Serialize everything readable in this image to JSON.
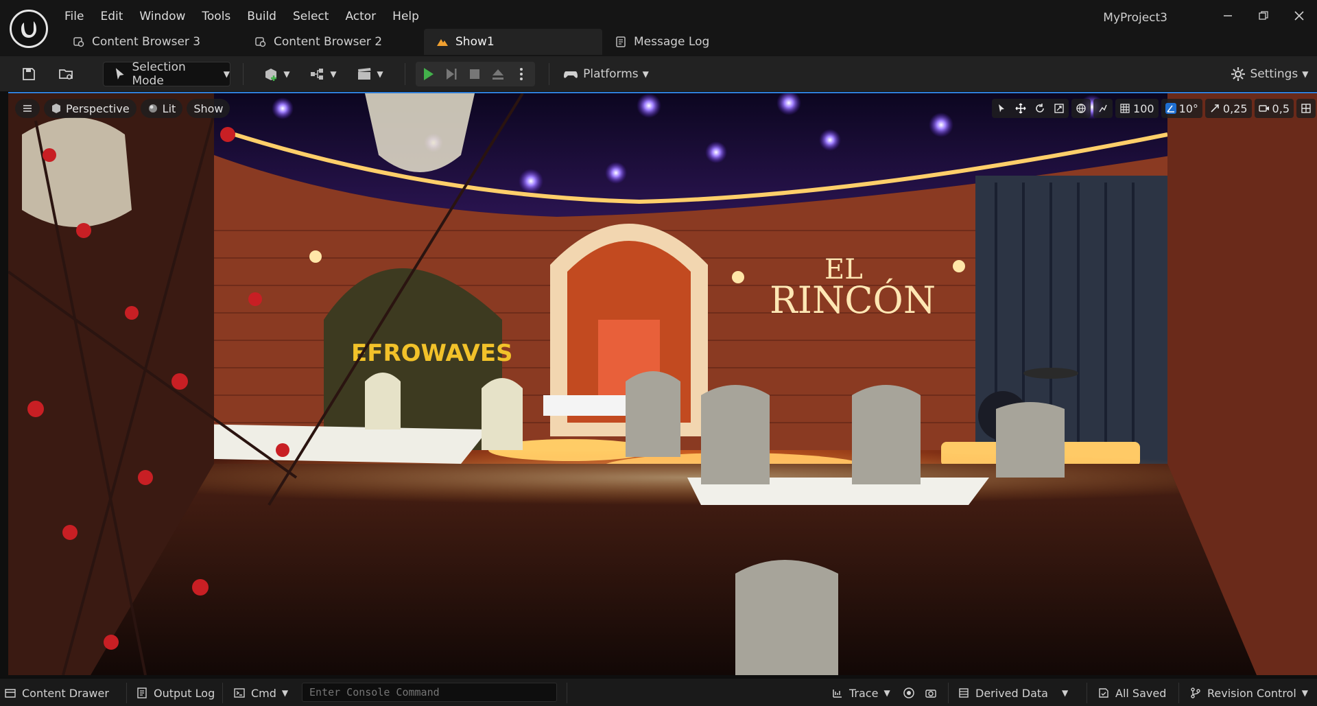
{
  "window": {
    "project_title": "MyProject3"
  },
  "menu": [
    "File",
    "Edit",
    "Window",
    "Tools",
    "Build",
    "Select",
    "Actor",
    "Help"
  ],
  "tabs": {
    "cb3": "Content Browser 3",
    "cb2": "Content Browser 2",
    "show": "Show1",
    "log": "Message Log"
  },
  "toolbar": {
    "selection_mode": "Selection Mode",
    "platforms": "Platforms",
    "settings": "Settings"
  },
  "viewport": {
    "perspective": "Perspective",
    "lit": "Lit",
    "show": "Show",
    "grid_size": "100",
    "rotation_snap": "10°",
    "scale_snap": "0,25",
    "camera_speed": "0,5",
    "scene_text": {
      "poster": "EFROWAVES",
      "sign_line1": "EL",
      "sign_line2": "RINCÓN"
    }
  },
  "statusbar": {
    "content_drawer": "Content Drawer",
    "output_log": "Output Log",
    "cmd": "Cmd",
    "console_placeholder": "Enter Console Command",
    "trace": "Trace",
    "derived_data": "Derived Data",
    "all_saved": "All Saved",
    "revision_control": "Revision Control"
  },
  "colors": {
    "accent": "#1f6fd1",
    "play": "#43b14b",
    "stage_glow": "#ffb347"
  }
}
